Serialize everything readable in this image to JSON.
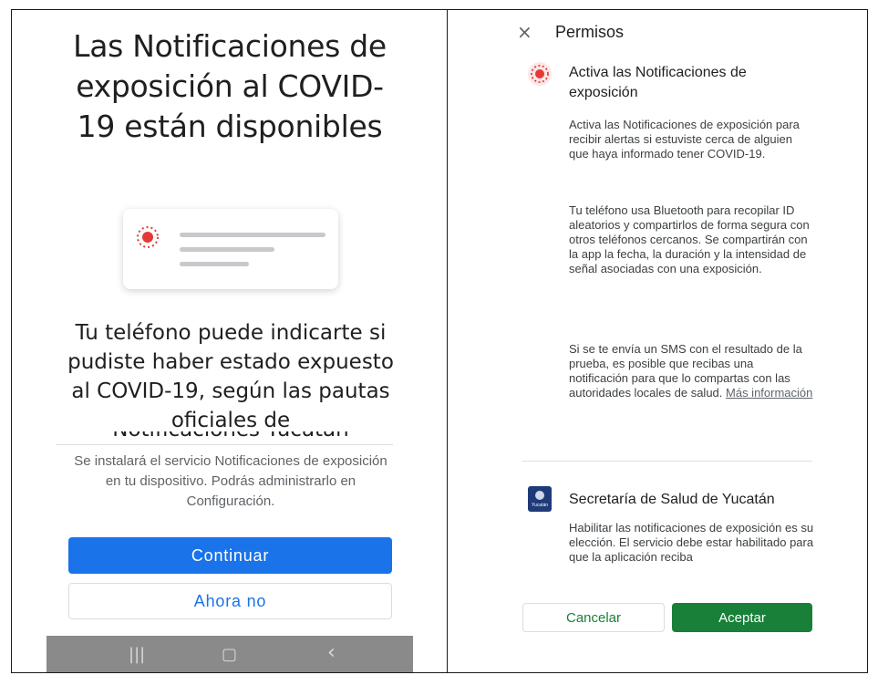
{
  "left": {
    "title": "Las Notificaciones de exposición al COVID-19 están disponibles",
    "description": "Tu teléfono puede indicarte si pudiste haber estado expuesto al COVID-19, según las pautas oficiales de",
    "description_clipped": "Notificaciones Yucatán",
    "install_note": "Se instalará el servicio Notificaciones de exposición en tu dispositivo. Podrás administrarlo en Configuración.",
    "continue_label": "Continuar",
    "not_now_label": "Ahora no",
    "nav": {
      "recents": "|||",
      "home": "▢",
      "back": "‹"
    }
  },
  "right": {
    "close_icon": "×",
    "header_title": "Permisos",
    "section1_title": "Activa las Notificaciones de exposición",
    "paragraph1": "Activa las Notificaciones de exposición para recibir alertas si estuviste cerca de alguien que haya informado tener COVID-19.",
    "paragraph2": "Tu teléfono usa Bluetooth para recopilar ID aleatorios y compartirlos de forma segura con otros teléfonos cercanos. Se compartirán con la app la fecha, la duración y la intensidad de señal asociadas con una exposición.",
    "paragraph3": "Si se te envía un SMS con el resultado de la prueba, es posible que recibas una notificación para que lo compartas con las autoridades locales de salud.",
    "more_info_label": "Más información",
    "section2_title": "Secretaría de Salud de Yucatán",
    "logo_text": "Yucatán",
    "paragraph4": "Habilitar las notificaciones de exposición es su elección. El servicio debe estar habilitado para que la aplicación reciba",
    "cancel_label": "Cancelar",
    "accept_label": "Aceptar"
  },
  "colors": {
    "primary_blue": "#1a73e8",
    "accept_green": "#188038",
    "exposure_red": "#e53935",
    "nav_gray": "#8a8a8a"
  },
  "icons": [
    "exposure-notification-icon",
    "close-icon",
    "health-secretariat-logo"
  ]
}
